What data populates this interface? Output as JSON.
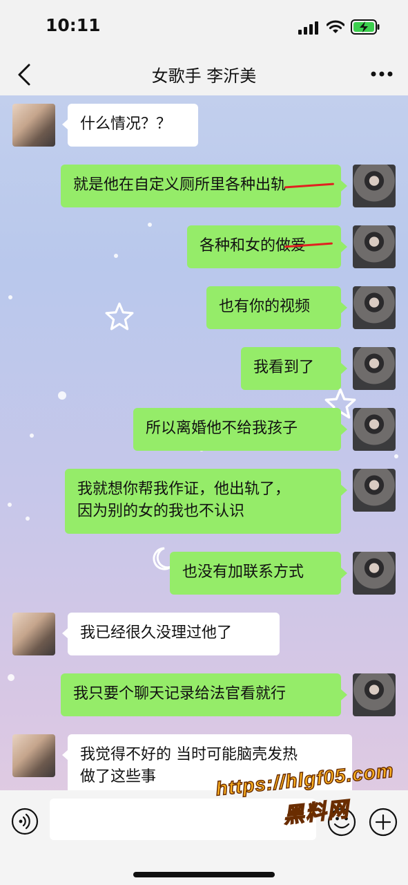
{
  "status_bar": {
    "time": "10:11",
    "icons": [
      "cellular-signal-icon",
      "wifi-icon",
      "battery-charging-icon"
    ]
  },
  "nav": {
    "title": "女歌手 李沂美",
    "back_icon": "chevron-left-icon",
    "more_icon": "more-dots-icon"
  },
  "messages": [
    {
      "side": "left",
      "text": "什么情况？？"
    },
    {
      "side": "right",
      "text": "就是他在自定义厕所里各种出轨",
      "struck": "出轨"
    },
    {
      "side": "right",
      "text": "各种和女的做爱",
      "struck": "做爱"
    },
    {
      "side": "right",
      "text": "也有你的视频"
    },
    {
      "side": "right",
      "text": "我看到了"
    },
    {
      "side": "right",
      "text": "所以离婚他不给我孩子"
    },
    {
      "side": "right",
      "text": "我就想你帮我作证，他出轨了，\n因为别的女的我也不认识"
    },
    {
      "side": "right",
      "text": "也没有加联系方式"
    },
    {
      "side": "left",
      "text": "我已经很久没理过他了"
    },
    {
      "side": "right",
      "text": "我只要个聊天记录给法官看就行"
    },
    {
      "side": "left",
      "text": "我觉得不好的 当时可能脑壳发热\n做了这些事"
    }
  ],
  "input_bar": {
    "voice_icon": "voice-input-icon",
    "input_value": "",
    "emoji_icon": "emoji-icon",
    "plus_icon": "plus-icon"
  },
  "watermark": {
    "url": "https://hlgf05.com",
    "text": "黑料网"
  },
  "colors": {
    "bubble_sent": "#95ec69",
    "bubble_received": "#ffffff",
    "strike": "#e02020",
    "watermark": "#ffb321"
  }
}
